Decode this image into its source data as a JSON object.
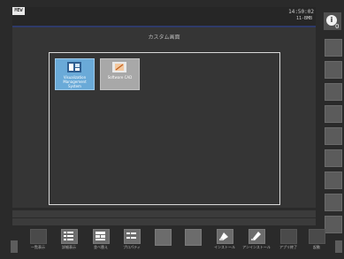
{
  "header": {
    "badge": "MEW",
    "time": "14:50:02",
    "date": "11-BMB"
  },
  "main": {
    "title": "カスタム画面",
    "apps": [
      {
        "label": "Visualization Management System"
      },
      {
        "label": "Software CAD"
      }
    ]
  },
  "notifications": {
    "count": "0"
  },
  "toolbar": {
    "items": [
      {
        "label": "一覧表示",
        "enabled": false
      },
      {
        "label": "詳細表示",
        "enabled": true
      },
      {
        "label": "並べ替え",
        "enabled": true
      },
      {
        "label": "プロパティ",
        "enabled": true
      },
      {
        "label": "",
        "enabled": false
      },
      {
        "label": "",
        "enabled": false
      },
      {
        "label": "インストール",
        "enabled": true
      },
      {
        "label": "アンインストール",
        "enabled": true
      },
      {
        "label": "アプリ終了",
        "enabled": false
      },
      {
        "label": "起動",
        "enabled": false
      }
    ]
  },
  "colors": {
    "accent_blue": "#6aaad8",
    "background": "#2b2b2b"
  }
}
